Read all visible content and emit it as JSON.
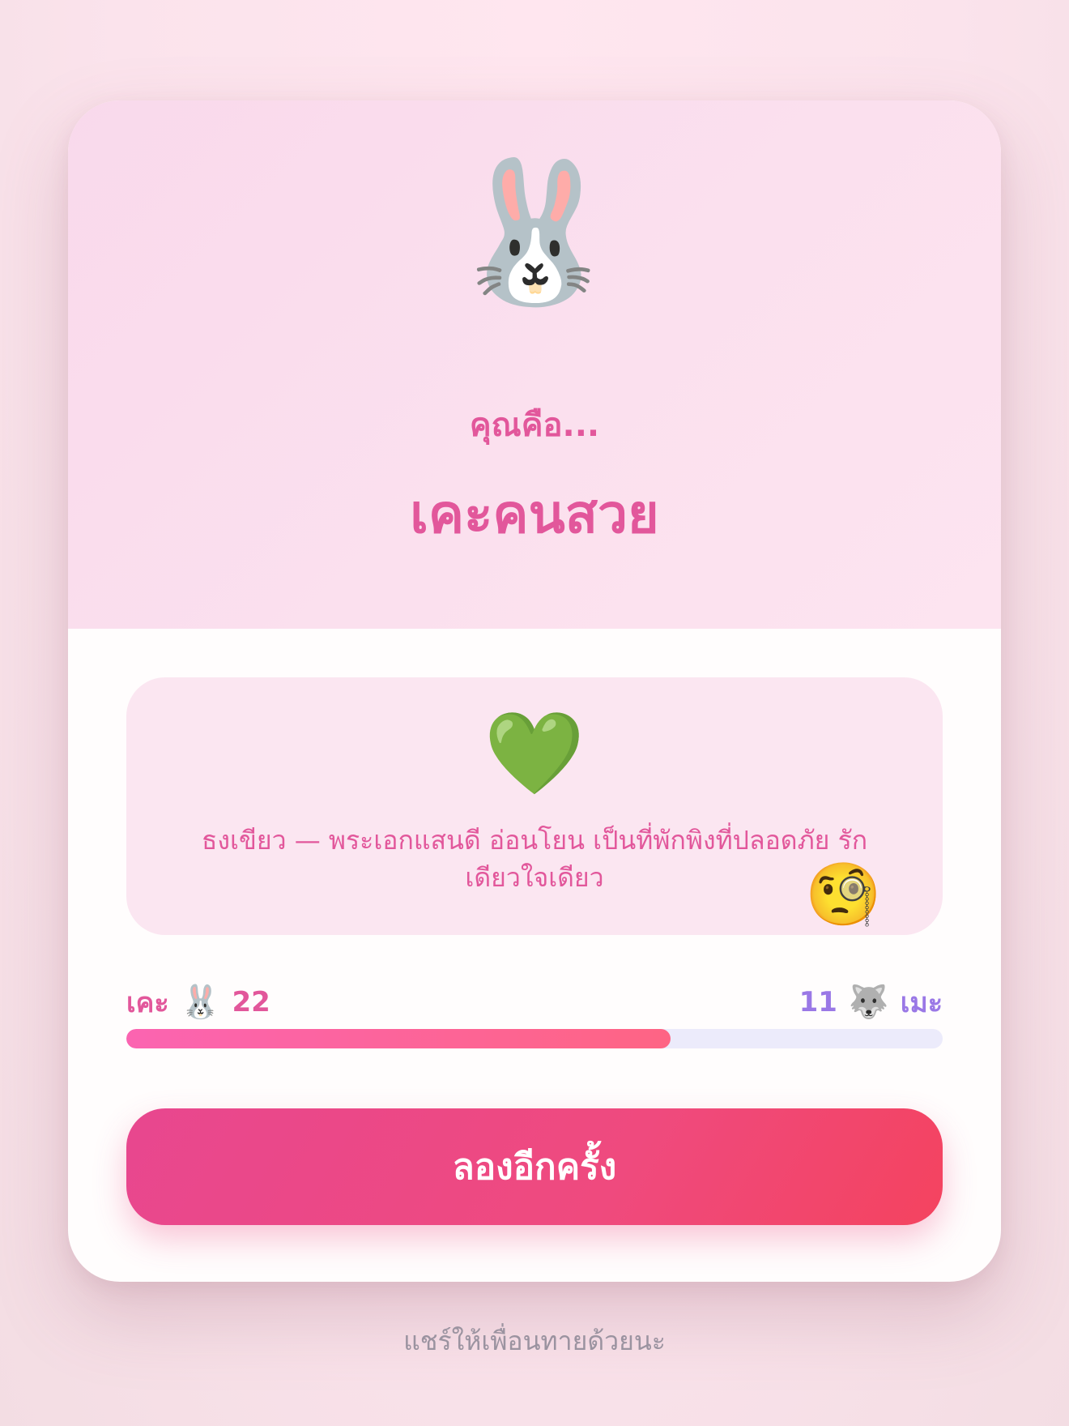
{
  "hero": {
    "emoji": "🐰",
    "eyebrow": "คุณคือ...",
    "title": "เคะคนสวย"
  },
  "description": {
    "emoji": "💚",
    "text": "ธงเขียว — พระเอกแสนดี อ่อนโยน เป็นที่พักพิงที่ปลอดภัย รักเดียวใจเดียว",
    "corner_emoji": "🧐"
  },
  "score": {
    "left_name": "เคะ",
    "left_emoji": "🐰",
    "left_value": "22",
    "right_value": "11",
    "right_emoji": "🐺",
    "right_name": "เมะ",
    "left_fraction": 0.6667
  },
  "actions": {
    "retry_label": "ลองอีกครั้ง"
  },
  "footer": {
    "share_hint": "แชร์ให้เพื่อนทายด้วยนะ"
  },
  "colors": {
    "accent_pink": "#e2579b",
    "accent_purple": "#9a78e6",
    "button_gradient_start": "#e8478f",
    "button_gradient_end": "#f4435f"
  }
}
